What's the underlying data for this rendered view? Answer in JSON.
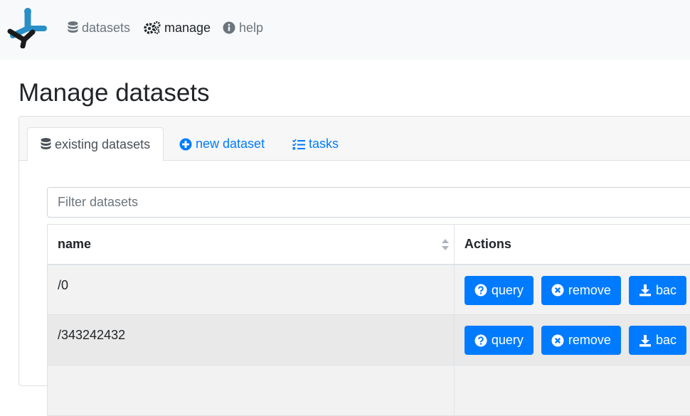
{
  "navbar": {
    "items": [
      {
        "label": "datasets",
        "icon": "database-icon",
        "active": false
      },
      {
        "label": "manage",
        "icon": "gears-icon",
        "active": true
      },
      {
        "label": "help",
        "icon": "info-circle-icon",
        "active": false
      }
    ]
  },
  "page": {
    "title": "Manage datasets"
  },
  "tabs": [
    {
      "label": "existing datasets",
      "icon": "database-icon",
      "active": true
    },
    {
      "label": "new dataset",
      "icon": "plus-circle-icon",
      "active": false
    },
    {
      "label": "tasks",
      "icon": "tasks-icon",
      "active": false
    }
  ],
  "filter": {
    "placeholder": "Filter datasets",
    "value": ""
  },
  "table": {
    "columns": [
      "name",
      "Actions"
    ],
    "rows": [
      {
        "name": "/0"
      },
      {
        "name": "/343242432"
      }
    ],
    "actions": {
      "query": "query",
      "remove": "remove",
      "backup": "bac"
    }
  },
  "colors": {
    "primary": "#007bff",
    "navbar_bg": "#f8f9fa",
    "row_odd": "#f2f2f2",
    "row_even": "#e9e9e9"
  }
}
